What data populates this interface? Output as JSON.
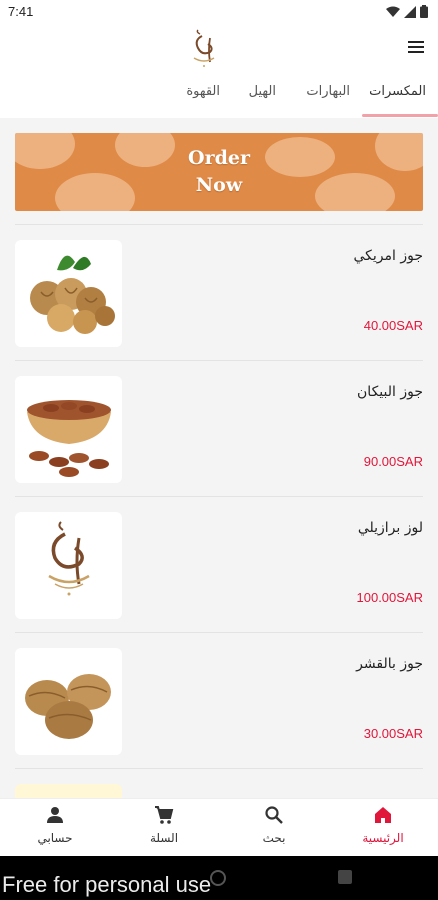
{
  "status_bar": {
    "time": "7:41"
  },
  "tabs": [
    {
      "label": "المكسرات",
      "active": true
    },
    {
      "label": "البهارات",
      "active": false
    },
    {
      "label": "الهيل",
      "active": false
    },
    {
      "label": "القهوة",
      "active": false
    }
  ],
  "banner": {
    "line1": "Order",
    "line2": "Now"
  },
  "products": [
    {
      "name": "جوز امريكي",
      "price": "40.00SAR",
      "image": "walnuts-image"
    },
    {
      "name": "جوز البيكان",
      "price": "90.00SAR",
      "image": "pecans-bowl-image"
    },
    {
      "name": "لوز برازيلي",
      "price": "100.00SAR",
      "image": "brand-logo-placeholder-image"
    },
    {
      "name": "جوز بالقشر",
      "price": "30.00SAR",
      "image": "whole-walnuts-image"
    }
  ],
  "bottom_nav": [
    {
      "label": "الرئيسية",
      "icon": "home-icon",
      "active": true
    },
    {
      "label": "بحث",
      "icon": "search-icon",
      "active": false
    },
    {
      "label": "السلة",
      "icon": "cart-icon",
      "active": false
    },
    {
      "label": "حسابي",
      "icon": "person-icon",
      "active": false
    }
  ],
  "watermark": "Free for personal use",
  "colors": {
    "accent": "#e0163b",
    "banner": "#df8a47",
    "tab_indicator": "#f2a1a8"
  }
}
